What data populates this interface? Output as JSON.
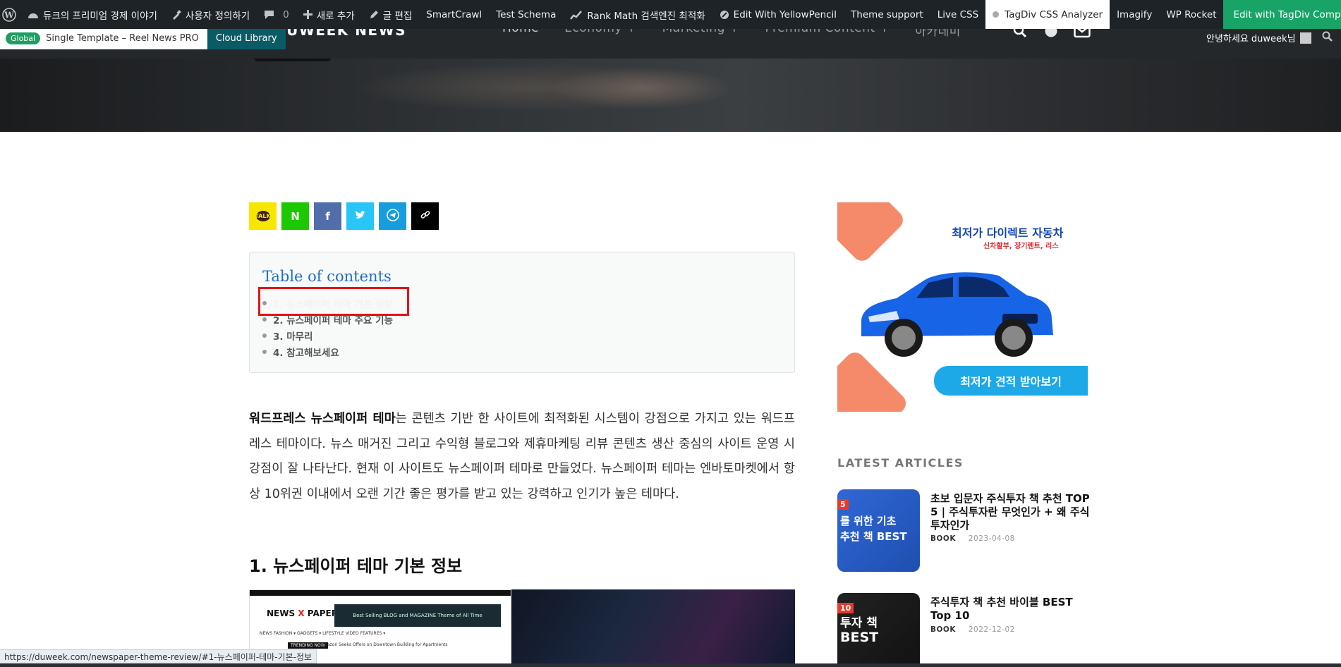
{
  "admin_bar": {
    "site_name": "듀크의 프리미엄 경제 이야기",
    "customize": "사용자 정의하기",
    "comments_count": "0",
    "new_item": "새로 추가",
    "edit_post": "글 편집",
    "smartcrawl": "SmartCrawl",
    "test_schema": "Test Schema",
    "rank_math": "Rank Math 검색엔진 최적화",
    "yellow_pencil": "Edit With YellowPencil",
    "theme_support": "Theme support",
    "live_css": "Live CSS",
    "css_analyzer": "TagDiv CSS Analyzer",
    "imagify": "Imagify",
    "wp_rocket": "WP Rocket",
    "composer": "Edit with TagDiv Composer"
  },
  "global_bar": {
    "badge": "Global",
    "template": "Single Template – Reel News PRO",
    "cloud_library": "Cloud Library"
  },
  "header": {
    "brand": "DUWEEK NEWS",
    "nav": [
      "Home",
      "Economy  +",
      "Marketing  +",
      "Premium Content  +",
      "아카데미"
    ],
    "greeting": "안녕하세요 duweek님"
  },
  "share": {
    "kakao": "TALK",
    "naver": "N",
    "facebook": "f"
  },
  "toc": {
    "title": "Table of contents",
    "items": [
      "1. 뉴스페이퍼 테마 기본 정보",
      "2. 뉴스페이퍼 테마 주요 기능",
      "3. 마무리",
      "4. 참고해보세요"
    ]
  },
  "article": {
    "intro_bold": "워드프레스 뉴스페이퍼 테마",
    "intro_rest": "는 콘텐츠 기반 한 사이트에 최적화된 시스템이 강점으로 가지고 있는 워드프레스 테마이다. 뉴스 매거진 그리고 수익형 블로그와 제휴마케팅 리뷰 콘텐츠 생산 중심의 사이트 운영 시 강점이 잘 나타난다. 현재 이 사이트도 뉴스페이퍼 테마로 만들었다. 뉴스페이퍼 테마는 엔바토마켓에서 항상 10위권 이내에서 오랜 기간 좋은 평가를 받고 있는 강력하고 인기가 높은 테마다.",
    "heading": "1. 뉴스페이퍼 테마 기본 정보",
    "image": {
      "logo_left": "NEWS",
      "logo_mark": "X",
      "logo_right": "PAPER",
      "ad_text": "Best Selling BLOG and MAGAZINE Theme of All Time",
      "menu": "NEWS   FASHION ▾   GADGETS ▾   LIFESTYLE   VIDEO   FEATURES ▾",
      "trending": "TRENDING NOW",
      "news_line": "Amazon Seeks Offers on Downtown Building for Apartments"
    }
  },
  "sidebar": {
    "ad": {
      "title": "최저가 다이렉트 자동차",
      "subtitle": "신차할부, 장기렌트, 리스",
      "cta": "최저가 견적 받아보기"
    },
    "latest_title": "LATEST ARTICLES",
    "posts": [
      {
        "title": "초보 입문자 주식투자 책 추천 TOP 5 | 주식투자란 무엇인가 + 왜 주식투자인가",
        "category": "BOOK",
        "date": "2023-04-08",
        "thumb_num": "5",
        "thumb_text_1": "를 위한 기초",
        "thumb_text_2": "추천 책 BEST"
      },
      {
        "title": "주식투자 책 추천 바이블 BEST Top 10",
        "category": "BOOK",
        "date": "2022-12-02",
        "thumb_num": "10",
        "thumb_text_1": "투자 책",
        "thumb_text_2": "BEST"
      }
    ]
  },
  "status_bar": {
    "url": "https://duweek.com/newspaper-theme-review/#1-뉴스페이퍼-테마-기본-정보"
  },
  "colors": {
    "admin_bar": "#1d2327",
    "header": "#25282b",
    "toc_title": "#1f6fbf",
    "highlight": "#e3121b",
    "composer": "#18a466"
  }
}
